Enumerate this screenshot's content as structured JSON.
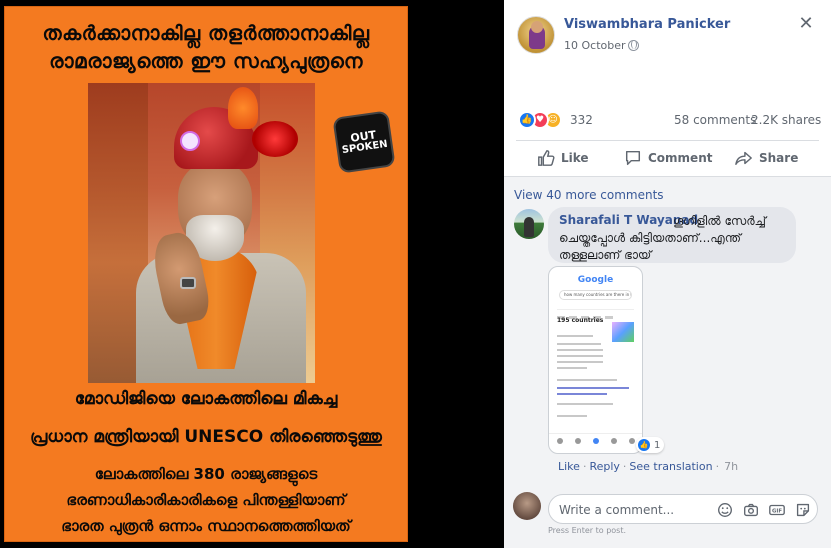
{
  "poster": {
    "line1": "തകർക്കാനാകില്ല തളർത്താനാകില്ല",
    "line2": "രാമരാജ്യത്തെ ഈ സഹ്യപുത്രനെ",
    "line3": "മോഡിജിയെ ലോകത്തിലെ മികച്ച",
    "line4": "പ്രധാന മന്ത്രിയായി UNESCO തിരഞ്ഞെടുത്തു",
    "line5": "ലോകത്തിലെ 380 രാജ്യങ്ങളുടെ",
    "line6": "ഭരണാധികാരികാരികളെ പിന്തള്ളിയാണ്",
    "line7": "ഭാരത പുത്രൻ ഒന്നാം സ്ഥാനത്തെത്തിയത്",
    "logo_line1": "OUT",
    "logo_line2": "SPOKEN"
  },
  "post": {
    "author": "Viswambhara Panicker",
    "date": "10 October",
    "close_symbol": "✕",
    "reaction_count": "332",
    "comments_count": "58 comments",
    "shares_count": "2.2K shares",
    "actions": {
      "like": "Like",
      "comment": "Comment",
      "share": "Share"
    }
  },
  "comments": {
    "view_more": "View 40 more comments",
    "items": [
      {
        "author": "Sharafali T Wayanad",
        "text": "ഗൂഗിളിൽ സേർച്ച് ചെയ്തപ്പോൾ കിട്ടിയതാണ്...എന്ത് തള്ളലാണ് ഭായ്",
        "likes": "1",
        "like_label": "Like",
        "reply_label": "Reply",
        "translate_label": "See translation",
        "time": "7h",
        "attachment": {
          "logo": "Google",
          "search": "how many countries are there in the world",
          "title": "195 countries"
        }
      }
    ],
    "input_placeholder": "Write a comment...",
    "hint": "Press Enter to post."
  },
  "colors": {
    "poster_orange": "#f47a20",
    "link_blue": "#385898",
    "like_blue": "#1877f2",
    "love_red": "#f33e58",
    "haha_yellow": "#f7b125"
  }
}
